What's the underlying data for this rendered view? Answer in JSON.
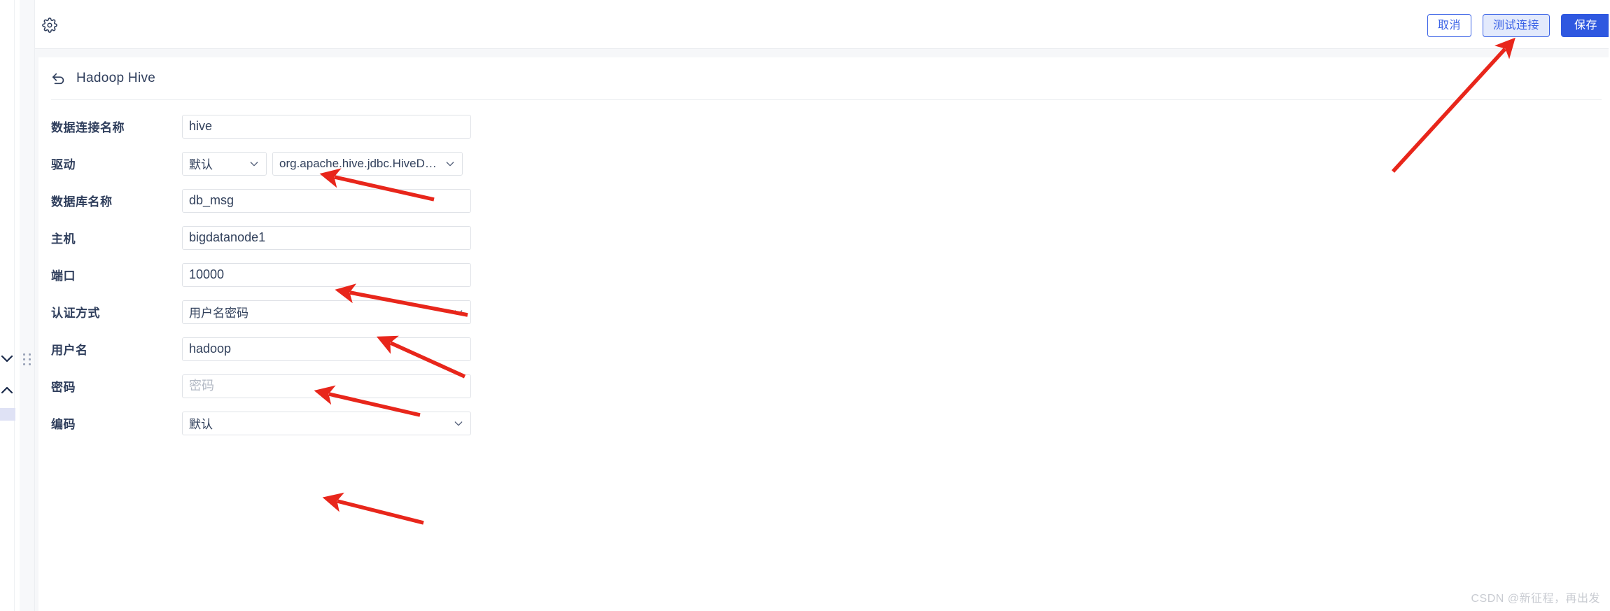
{
  "toolbar": {
    "gear_icon": "gear-icon",
    "buttons": [
      {
        "label": "取消",
        "style": "ghost"
      },
      {
        "label": "测试连接",
        "style": "ghost-hover"
      },
      {
        "label": "保存",
        "style": "primary"
      }
    ]
  },
  "card": {
    "back_icon": "back-arrow-icon",
    "title": "Hadoop Hive"
  },
  "form": {
    "rows": [
      {
        "label": "数据连接名称",
        "type": "input",
        "value": "hive",
        "placeholder": ""
      },
      {
        "label": "驱动",
        "type": "dual-select",
        "value": "默认",
        "value2": "org.apache.hive.jdbc.HiveDri…"
      },
      {
        "label": "数据库名称",
        "type": "input",
        "value": "db_msg",
        "placeholder": ""
      },
      {
        "label": "主机",
        "type": "input",
        "value": "bigdatanode1",
        "placeholder": ""
      },
      {
        "label": "端口",
        "type": "input",
        "value": "10000",
        "placeholder": ""
      },
      {
        "label": "认证方式",
        "type": "select",
        "value": "用户名密码"
      },
      {
        "label": "用户名",
        "type": "input",
        "value": "hadoop",
        "placeholder": ""
      },
      {
        "label": "密码",
        "type": "input",
        "value": "",
        "placeholder": "密码"
      },
      {
        "label": "编码",
        "type": "select",
        "value": "默认"
      }
    ]
  },
  "rail": {
    "chevron_down": "chevron-down-icon",
    "chevron_up": "chevron-up-icon",
    "drag_handle": "drag-handle-icon"
  },
  "watermark": {
    "text": "CSDN @新征程，再出发"
  },
  "colors": {
    "accent_blue": "#2f58e0",
    "border_blue": "#3b63e6",
    "hover_blue_bg": "#e3eafc",
    "text_dark": "#2f3e5c",
    "canvas_bg": "#f6f7f9",
    "annotation_red": "#e8261b"
  }
}
